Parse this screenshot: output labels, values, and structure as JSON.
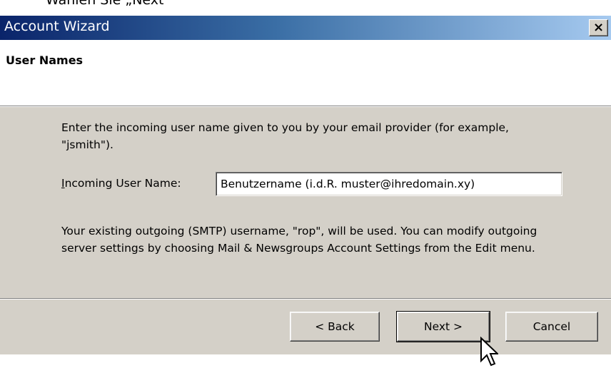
{
  "caption": "Wählen Sie „Next“",
  "window": {
    "title": "Account Wizard",
    "close_label": "×"
  },
  "header": {
    "title": "User Names"
  },
  "content": {
    "description": "Enter the incoming user name given to you by your email provider (for example, \"jsmith\").",
    "field_label_accesskey": "I",
    "field_label_rest": "ncoming User Name:",
    "field_value": "Benutzername (i.d.R. muster@ihredomain.xy)",
    "note": "Your existing outgoing (SMTP) username, \"rop\", will be used. You can modify outgoing server settings by choosing Mail & Newsgroups Account Settings from the Edit menu."
  },
  "buttons": {
    "back": "< Back",
    "next": "Next >",
    "cancel": "Cancel"
  },
  "colors": {
    "title_gradient_start": "#0a246a",
    "title_gradient_end": "#a6caf0",
    "dialog_face": "#d4d0c8"
  },
  "icons": {
    "close": "close-icon",
    "cursor": "mouse-pointer-icon"
  }
}
